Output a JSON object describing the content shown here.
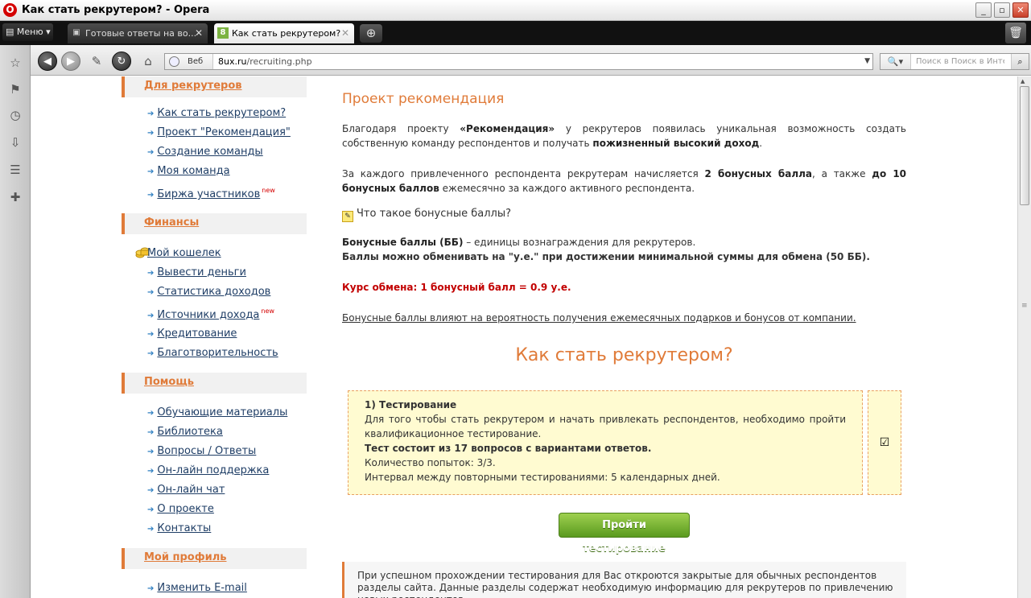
{
  "window": {
    "title": "Как стать рекрутером? - Opera",
    "logo_letter": "O"
  },
  "tabs": {
    "menu_label": "Меню",
    "items": [
      {
        "label": "Готовые ответы на во...",
        "active": false
      },
      {
        "label": "Как стать рекрутером?",
        "active": true
      }
    ],
    "new_tab_icon": "plus-icon",
    "trash_icon": "trash-icon"
  },
  "toolbar": {
    "address_mode": "Веб",
    "url_domain": "8ux.ru",
    "url_path": "/recruiting.php",
    "search_placeholder": "Поиск в Поиск в Инте"
  },
  "sidebar": {
    "sections": [
      {
        "heading": "Для рекрутеров",
        "items": [
          {
            "label": "Как стать рекрутером?",
            "new": ""
          },
          {
            "label": "Проект \"Рекомендация\"",
            "new": ""
          },
          {
            "label": "Создание команды",
            "new": ""
          },
          {
            "label": "Моя команда",
            "new": ""
          },
          {
            "label": "Биржа участников",
            "new": "new"
          }
        ]
      },
      {
        "heading": "Финансы",
        "items": [
          {
            "label": "Мой кошелек",
            "new": ""
          },
          {
            "label": "Вывести деньги",
            "new": ""
          },
          {
            "label": "Статистика доходов",
            "new": ""
          },
          {
            "label": "Источники дохода",
            "new": "new"
          },
          {
            "label": "Кредитование",
            "new": ""
          },
          {
            "label": "Благотворительность",
            "new": ""
          }
        ]
      },
      {
        "heading": "Помощь",
        "items": [
          {
            "label": "Обучающие материалы",
            "new": ""
          },
          {
            "label": "Библиотека",
            "new": ""
          },
          {
            "label": "Вопросы / Ответы",
            "new": ""
          },
          {
            "label": "Он-лайн поддержка",
            "new": ""
          },
          {
            "label": "Он-лайн чат",
            "new": ""
          },
          {
            "label": "О проекте",
            "new": ""
          },
          {
            "label": "Контакты",
            "new": ""
          }
        ]
      },
      {
        "heading": "Мой профиль",
        "items": [
          {
            "label": "Изменить E-mail",
            "new": ""
          }
        ]
      }
    ]
  },
  "main": {
    "heading": "Проект рекомендация",
    "p1": {
      "a": "Благодаря проекту ",
      "b": "«Рекомендация»",
      "c": " у рекрутеров появилась уникальная возможность создать собственную команду респондентов и получать ",
      "d": "пожизненный высокий доход",
      "e": "."
    },
    "p2": {
      "a": "За каждого привлеченного респондента рекрутерам начисляется ",
      "b": "2 бонусных балла",
      "c": ", а также ",
      "d": "до 10 бонусных баллов",
      "e": " ежемесячно за каждого активного респондента."
    },
    "bonus_question": "Что такое бонусные баллы?",
    "bonus_def_bold": "Бонусные баллы (ББ)",
    "bonus_def_rest": " – единицы вознаграждения для рекрутеров.",
    "bonus_exchange": "Баллы можно обменивать на \"у.е.\" при достижении минимальной суммы для обмена (50 ББ).",
    "rate": "Курс обмена:  1 бонусный балл = 0.9 у.е.",
    "influence": "Бонусные баллы влияют на вероятность получения ежемесячных подарков и бонусов от компании.",
    "how_title": "Как стать рекрутером?",
    "step": {
      "title": "1) Тестирование",
      "line1": "Для того чтобы стать рекрутером и начать привлекать респондентов, необходимо пройти квалификационное тестирование.",
      "line2": "Тест состоит из 17 вопросов с вариантами ответов.",
      "line3": "Количество попыток: 3/3.",
      "line4": "Интервал между повторными тестированиями: 5 календарных дней."
    },
    "test_button": "Пройти тестирование",
    "note": "При успешном прохождении тестирования для Вас откроются закрытые для обычных респондентов разделы сайта. Данные разделы содержат необходимую информацию для рекрутеров по привлечению новых респондентов."
  },
  "colors": {
    "accent": "#e07b39",
    "link": "#1f3e66",
    "rate": "#c20000",
    "button": "#6aa72a"
  }
}
